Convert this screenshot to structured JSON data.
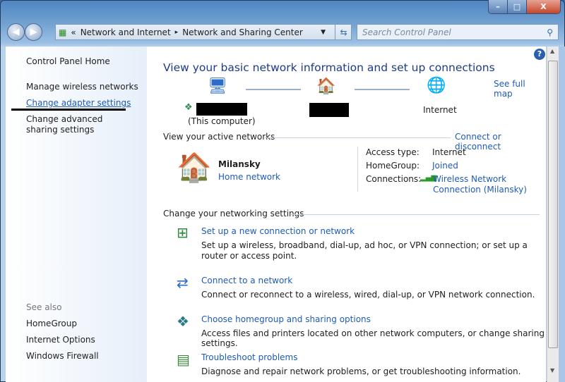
{
  "window": {
    "min": "–",
    "max": "□",
    "close": "X"
  },
  "address": {
    "chevrons": "«",
    "crumbs": [
      "Network and Internet",
      "Network and Sharing Center"
    ],
    "sep": "▸"
  },
  "search": {
    "placeholder": "Search Control Panel"
  },
  "sidebar": {
    "items": [
      "Control Panel Home",
      "Manage wireless networks",
      "Change adapter settings",
      "Change advanced sharing settings"
    ],
    "see_also": "See also",
    "see_also_items": [
      "HomeGroup",
      "Internet Options",
      "Windows Firewall"
    ]
  },
  "main": {
    "title": "View your basic network information and set up connections",
    "see_full_map": "See full map",
    "map": {
      "computer_sub": "(This computer)",
      "internet": "Internet"
    },
    "active_header": "View your active networks",
    "connect_disconnect": "Connect or disconnect",
    "network": {
      "name": "Milansky",
      "type": "Home network"
    },
    "details": {
      "access_label": "Access type:",
      "access_value": "Internet",
      "homegroup_label": "HomeGroup:",
      "homegroup_value": "Joined",
      "connections_label": "Connections:",
      "connections_value1": "Wireless Network",
      "connections_value2": "Connection (Milansky)"
    },
    "settings_header": "Change your networking settings",
    "tasks": [
      {
        "title": "Set up a new connection or network",
        "desc": "Set up a wireless, broadband, dial-up, ad hoc, or VPN connection; or set up a router or access point."
      },
      {
        "title": "Connect to a network",
        "desc": "Connect or reconnect to a wireless, wired, dial-up, or VPN network connection."
      },
      {
        "title": "Choose homegroup and sharing options",
        "desc": "Access files and printers located on other network computers, or change sharing settings."
      },
      {
        "title": "Troubleshoot problems",
        "desc": "Diagnose and repair network problems, or get troubleshooting information."
      }
    ]
  },
  "help": "?"
}
